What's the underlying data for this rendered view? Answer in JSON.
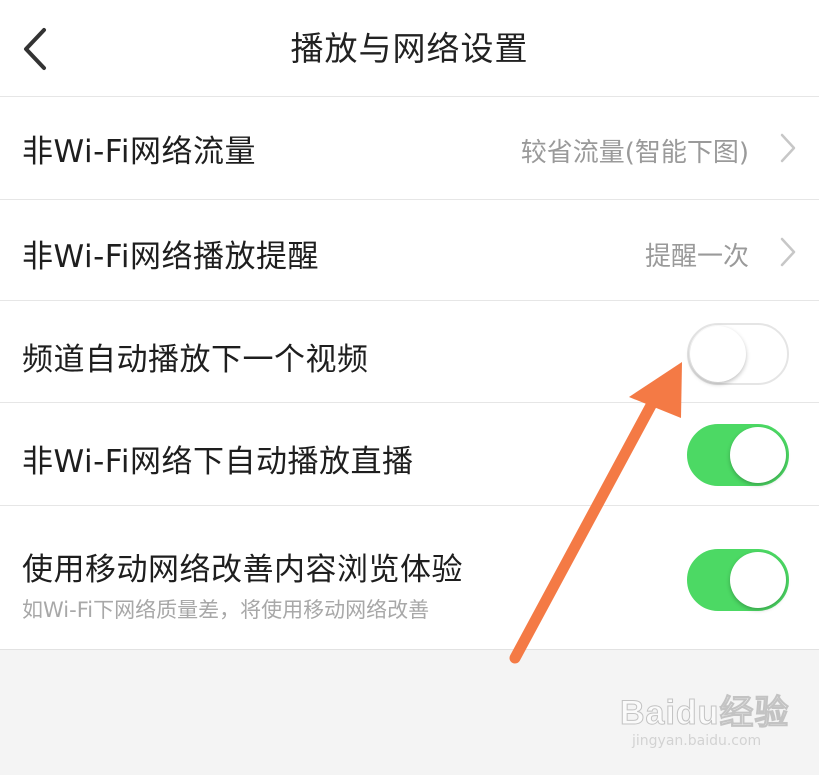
{
  "header": {
    "title": "播放与网络设置",
    "back_icon": "chevron-left-icon"
  },
  "settings": {
    "non_wifi_traffic": {
      "label": "非Wi-Fi网络流量",
      "value": "较省流量(智能下图)"
    },
    "non_wifi_play_reminder": {
      "label": "非Wi-Fi网络播放提醒",
      "value": "提醒一次"
    },
    "channel_autoplay_next": {
      "label": "频道自动播放下一个视频",
      "enabled": false
    },
    "non_wifi_autoplay_live": {
      "label": "非Wi-Fi网络下自动播放直播",
      "enabled": true
    },
    "mobile_network_improve": {
      "label": "使用移动网络改善内容浏览体验",
      "description": "如Wi-Fi下网络质量差，将使用移动网络改善",
      "enabled": true
    }
  },
  "colors": {
    "toggle_on": "#4cd964",
    "toggle_off_border": "#e5e5e5",
    "annotation_arrow": "#f47a45",
    "background": "#f4f4f4"
  },
  "watermark": {
    "brand": "Baidu经验",
    "url": "jingyan.baidu.com"
  }
}
